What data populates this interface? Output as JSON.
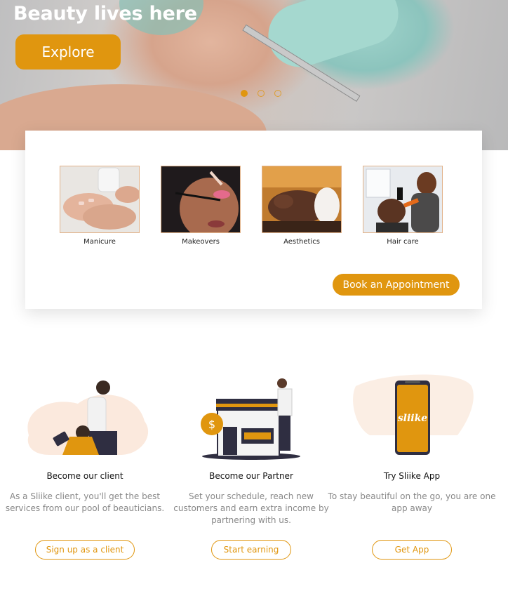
{
  "hero": {
    "title": "Beauty lives here",
    "explore_label": "Explore",
    "slides": 3,
    "active_slide": 1
  },
  "services": [
    {
      "label": "Manicure",
      "icon": "manicure-photo"
    },
    {
      "label": "Makeovers",
      "icon": "makeover-photo"
    },
    {
      "label": "Aesthetics",
      "icon": "aesthetics-photo"
    },
    {
      "label": "Hair care",
      "icon": "haircare-photo"
    }
  ],
  "book_label": "Book an Appointment",
  "columns": [
    {
      "heading": "Become our client",
      "description": "As a Sliike client, you'll get the best services from our pool of beauticians.",
      "button": "Sign up as a client"
    },
    {
      "heading": "Become our Partner",
      "description": "Set your schedule, reach new customers and earn extra income by partnering with us.",
      "button": "Start earning"
    },
    {
      "heading": "Try Sliike App",
      "description": "To stay beautiful on the go, you are one app away",
      "button": "Get App"
    }
  ],
  "app_logo_text": "sliike",
  "colors": {
    "accent": "#e0960f",
    "navy": "#2f2e41"
  }
}
